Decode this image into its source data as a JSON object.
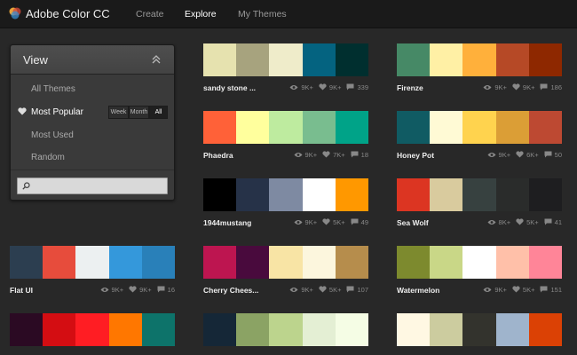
{
  "header": {
    "brand": "Adobe Color CC",
    "nav": [
      {
        "label": "Create",
        "active": false
      },
      {
        "label": "Explore",
        "active": true
      },
      {
        "label": "My Themes",
        "active": false
      }
    ]
  },
  "sidebar": {
    "title": "View",
    "items": [
      {
        "label": "All Themes",
        "active": false
      },
      {
        "label": "Most Popular",
        "active": true
      },
      {
        "label": "Most Used",
        "active": false
      },
      {
        "label": "Random",
        "active": false
      }
    ],
    "time_filters": [
      {
        "label": "Week",
        "active": false
      },
      {
        "label": "Month",
        "active": false
      },
      {
        "label": "All",
        "active": true
      }
    ],
    "search": {
      "value": "",
      "placeholder": ""
    }
  },
  "themes": [
    {
      "name": "sandy stone ...",
      "views": "9K+",
      "likes": "9K+",
      "comments": "339",
      "colors": [
        "#E6E2AF",
        "#A7A37E",
        "#EFECCA",
        "#046380",
        "#002F2F"
      ]
    },
    {
      "name": "Firenze",
      "views": "9K+",
      "likes": "9K+",
      "comments": "186",
      "colors": [
        "#468966",
        "#FFF0A5",
        "#FFB03B",
        "#B64926",
        "#8E2800"
      ]
    },
    {
      "name": "Phaedra",
      "views": "9K+",
      "likes": "7K+",
      "comments": "18",
      "colors": [
        "#FF6138",
        "#FFFF9D",
        "#BEEB9F",
        "#79BD8F",
        "#00A388"
      ]
    },
    {
      "name": "Honey Pot",
      "views": "9K+",
      "likes": "6K+",
      "comments": "50",
      "colors": [
        "#105B63",
        "#FFFAD5",
        "#FFD34E",
        "#DB9E36",
        "#BD4932"
      ]
    },
    {
      "name": "1944mustang",
      "views": "9K+",
      "likes": "5K+",
      "comments": "49",
      "colors": [
        "#000000",
        "#263248",
        "#7E8AA2",
        "#FFFFFF",
        "#FF9800"
      ]
    },
    {
      "name": "Sea Wolf",
      "views": "8K+",
      "likes": "5K+",
      "comments": "41",
      "colors": [
        "#DC3522",
        "#D9CB9E",
        "#374140",
        "#2A2C2B",
        "#1E1E20"
      ]
    },
    {
      "name": "Flat UI",
      "views": "9K+",
      "likes": "9K+",
      "comments": "16",
      "colors": [
        "#2C3E50",
        "#E74C3C",
        "#ECF0F1",
        "#3498DB",
        "#2980B9"
      ]
    },
    {
      "name": "Cherry Chees...",
      "views": "9K+",
      "likes": "5K+",
      "comments": "107",
      "colors": [
        "#BD1550",
        "#490A3D",
        "#F8E4A5",
        "#FCF6DD",
        "#B68D4C"
      ]
    },
    {
      "name": "Watermelon",
      "views": "9K+",
      "likes": "5K+",
      "comments": "151",
      "colors": [
        "#7D8A2E",
        "#C9D787",
        "#FFFFFF",
        "#FFC0A9",
        "#FF8598"
      ]
    },
    {
      "name": "",
      "views": "",
      "likes": "",
      "comments": "",
      "colors": [
        "#2B0A23",
        "#D40D12",
        "#FF1D23",
        "#FF7700",
        "#0D736A"
      ]
    },
    {
      "name": "",
      "views": "",
      "likes": "",
      "comments": "",
      "colors": [
        "#152737",
        "#8BA364",
        "#BCD48D",
        "#E4EFD4",
        "#F5FDE5"
      ]
    },
    {
      "name": "",
      "views": "",
      "likes": "",
      "comments": "",
      "colors": [
        "#FFF8E3",
        "#CCCC9F",
        "#33332D",
        "#9FB4CC",
        "#DB4105"
      ]
    }
  ]
}
